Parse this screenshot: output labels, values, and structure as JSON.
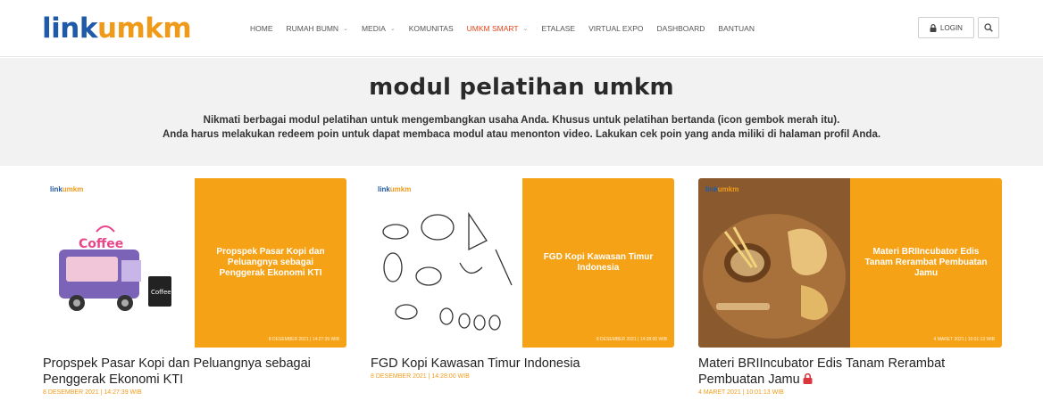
{
  "header": {
    "logo_part1": "link",
    "logo_part2": "umkm",
    "nav": [
      {
        "label": "HOME",
        "dropdown": false
      },
      {
        "label": "RUMAH BUMN",
        "dropdown": true
      },
      {
        "label": "MEDIA",
        "dropdown": true
      },
      {
        "label": "KOMUNITAS",
        "dropdown": false
      },
      {
        "label": "UMKM SMART",
        "dropdown": true,
        "active": true
      },
      {
        "label": "ETALASE",
        "dropdown": false
      },
      {
        "label": "VIRTUAL EXPO",
        "dropdown": false
      },
      {
        "label": "DASHBOARD",
        "dropdown": false
      },
      {
        "label": "BANTUAN",
        "dropdown": false
      }
    ],
    "login_label": "LOGIN",
    "login_icon": "lock-icon",
    "search_icon": "search-icon"
  },
  "hero": {
    "title": "modul pelatihan umkm",
    "line1": "Nikmati berbagai modul pelatihan untuk mengembangkan usaha Anda. Khusus untuk pelatihan bertanda (icon gembok merah itu).",
    "line2": "Anda harus melakukan redeem poin untuk dapat membaca modul atau menonton video. Lakukan cek poin yang anda miliki di halaman profil Anda."
  },
  "cards": [
    {
      "thumb_text": "Propspek Pasar Kopi dan Peluangnya sebagai Penggerak Ekonomi KTI",
      "title": "Propspek Pasar Kopi dan Peluangnya sebagai Penggerak Ekonomi KTI",
      "date": "8 DESEMBER 2021 | 14:27:39 WIB",
      "locked": false
    },
    {
      "thumb_text": "FGD Kopi Kawasan Timur Indonesia",
      "title": "FGD Kopi Kawasan Timur Indonesia",
      "date": "8 DESEMBER 2021 | 14:28:00 WIB",
      "locked": false
    },
    {
      "thumb_text": "Materi BRIIncubator Edis Tanam Rerambat Pembuatan Jamu",
      "title": "Materi BRIIncubator Edis Tanam Rerambat Pembuatan Jamu",
      "date": "4 MARET 2021 | 10:01:13 WIB",
      "locked": true
    }
  ],
  "colors": {
    "brand_blue": "#1f5aa8",
    "brand_orange": "#f09a1a",
    "active_nav": "#e8461a",
    "lock_red": "#d9363e"
  }
}
